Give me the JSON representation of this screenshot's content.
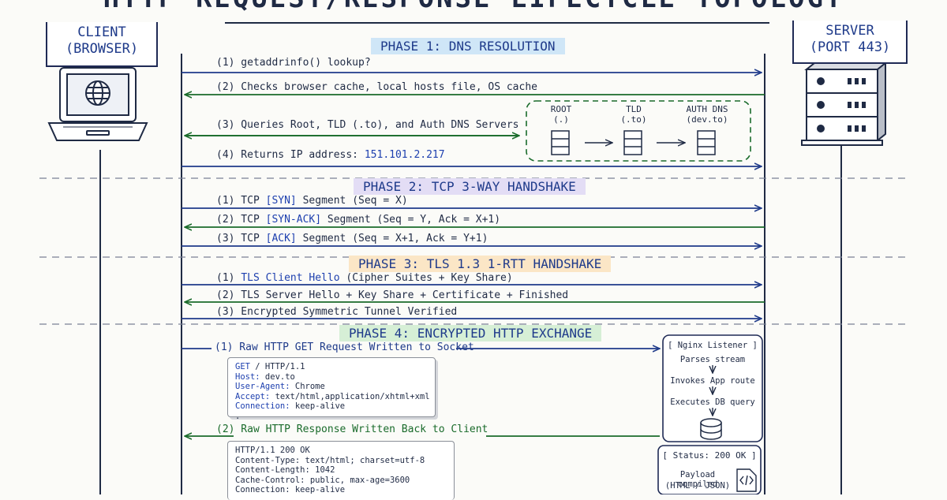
{
  "title": "HTTP REQUEST/RESPONSE LIFECYCLE TOPOLOGY",
  "actors": {
    "client": {
      "line1": "CLIENT",
      "line2": "(BROWSER)"
    },
    "server": {
      "line1": "SERVER",
      "line2": "(PORT 443)"
    }
  },
  "phases": [
    {
      "label": "PHASE 1: DNS RESOLUTION",
      "color": "#cfe6f7"
    },
    {
      "label": "PHASE 2: TCP 3-WAY HANDSHAKE",
      "color": "#e3ddf5"
    },
    {
      "label": "PHASE 3: TLS 1.3 1-RTT HANDSHAKE",
      "color": "#fbe6c6"
    },
    {
      "label": "PHASE 4: ENCRYPTED HTTP EXCHANGE",
      "color": "#d6efd6"
    }
  ],
  "dns": {
    "m1": "(1) getaddrinfo() lookup?",
    "m2": "(2) Checks browser cache, local hosts file, OS cache",
    "m3": "(3) Queries Root, TLD (.to), and Auth DNS Servers",
    "m4_prefix": "(4) Returns IP address:",
    "m4_ip": "151.101.2.217",
    "root": {
      "line1": "ROOT",
      "line2": "(.)"
    },
    "tld": {
      "line1": "TLD",
      "line2": "(.to)"
    },
    "auth": {
      "line1": "AUTH DNS",
      "line2": "(dev.to)"
    }
  },
  "tcp": {
    "m1": {
      "pre": "(1) TCP",
      "flag": "[SYN]",
      "post": "Segment  (Seq = X)"
    },
    "m2": {
      "pre": "(2) TCP",
      "flag": "[SYN-ACK]",
      "post": "Segment  (Seq = Y, Ack = X+1)"
    },
    "m3": {
      "pre": "(3) TCP",
      "flag": "[ACK]",
      "post": "Segment  (Seq = X+1, Ack = Y+1)"
    }
  },
  "tls": {
    "m1_num": "(1)",
    "m1_hl": "TLS Client Hello",
    "m1_post": "(Cipher Suites + Key Share)",
    "m2": "(2) TLS Server Hello + Key Share + Certificate + Finished",
    "m3": "(3) Encrypted Symmetric Tunnel Verified"
  },
  "http": {
    "request_label": "(1) Raw HTTP GET Request Written to Socket",
    "response_label": "(2) Raw HTTP Response Written Back to Client",
    "request_lines": [
      {
        "k": "GET",
        "v": " / HTTP/1.1"
      },
      {
        "k": "Host:",
        "v": " dev.to"
      },
      {
        "k": "User-Agent:",
        "v": " Chrome"
      },
      {
        "k": "Accept:",
        "v": " text/html,application/xhtml+xml"
      },
      {
        "k": "Connection:",
        "v": " keep-alive"
      },
      {
        "k": "",
        "v": "."
      }
    ],
    "response_lines": [
      "HTTP/1.1 200 OK",
      "Content-Type: text/html; charset=utf-8",
      "Content-Length: 1042",
      "Cache-Control: public, max-age=3600",
      "Connection: keep-alive"
    ],
    "nginx": {
      "title": "[ Nginx Listener ]",
      "s1": "Parses stream",
      "s2": "Invokes App route",
      "s3": "Executes DB query"
    },
    "status": {
      "title": "[ Status: 200 OK ]",
      "l1": "Payload compiled",
      "l2": "(HTML / JSON)"
    }
  },
  "colors": {
    "blue": "#1e3a8a",
    "green": "#1a6b2b",
    "ink": "#1f2a44"
  }
}
